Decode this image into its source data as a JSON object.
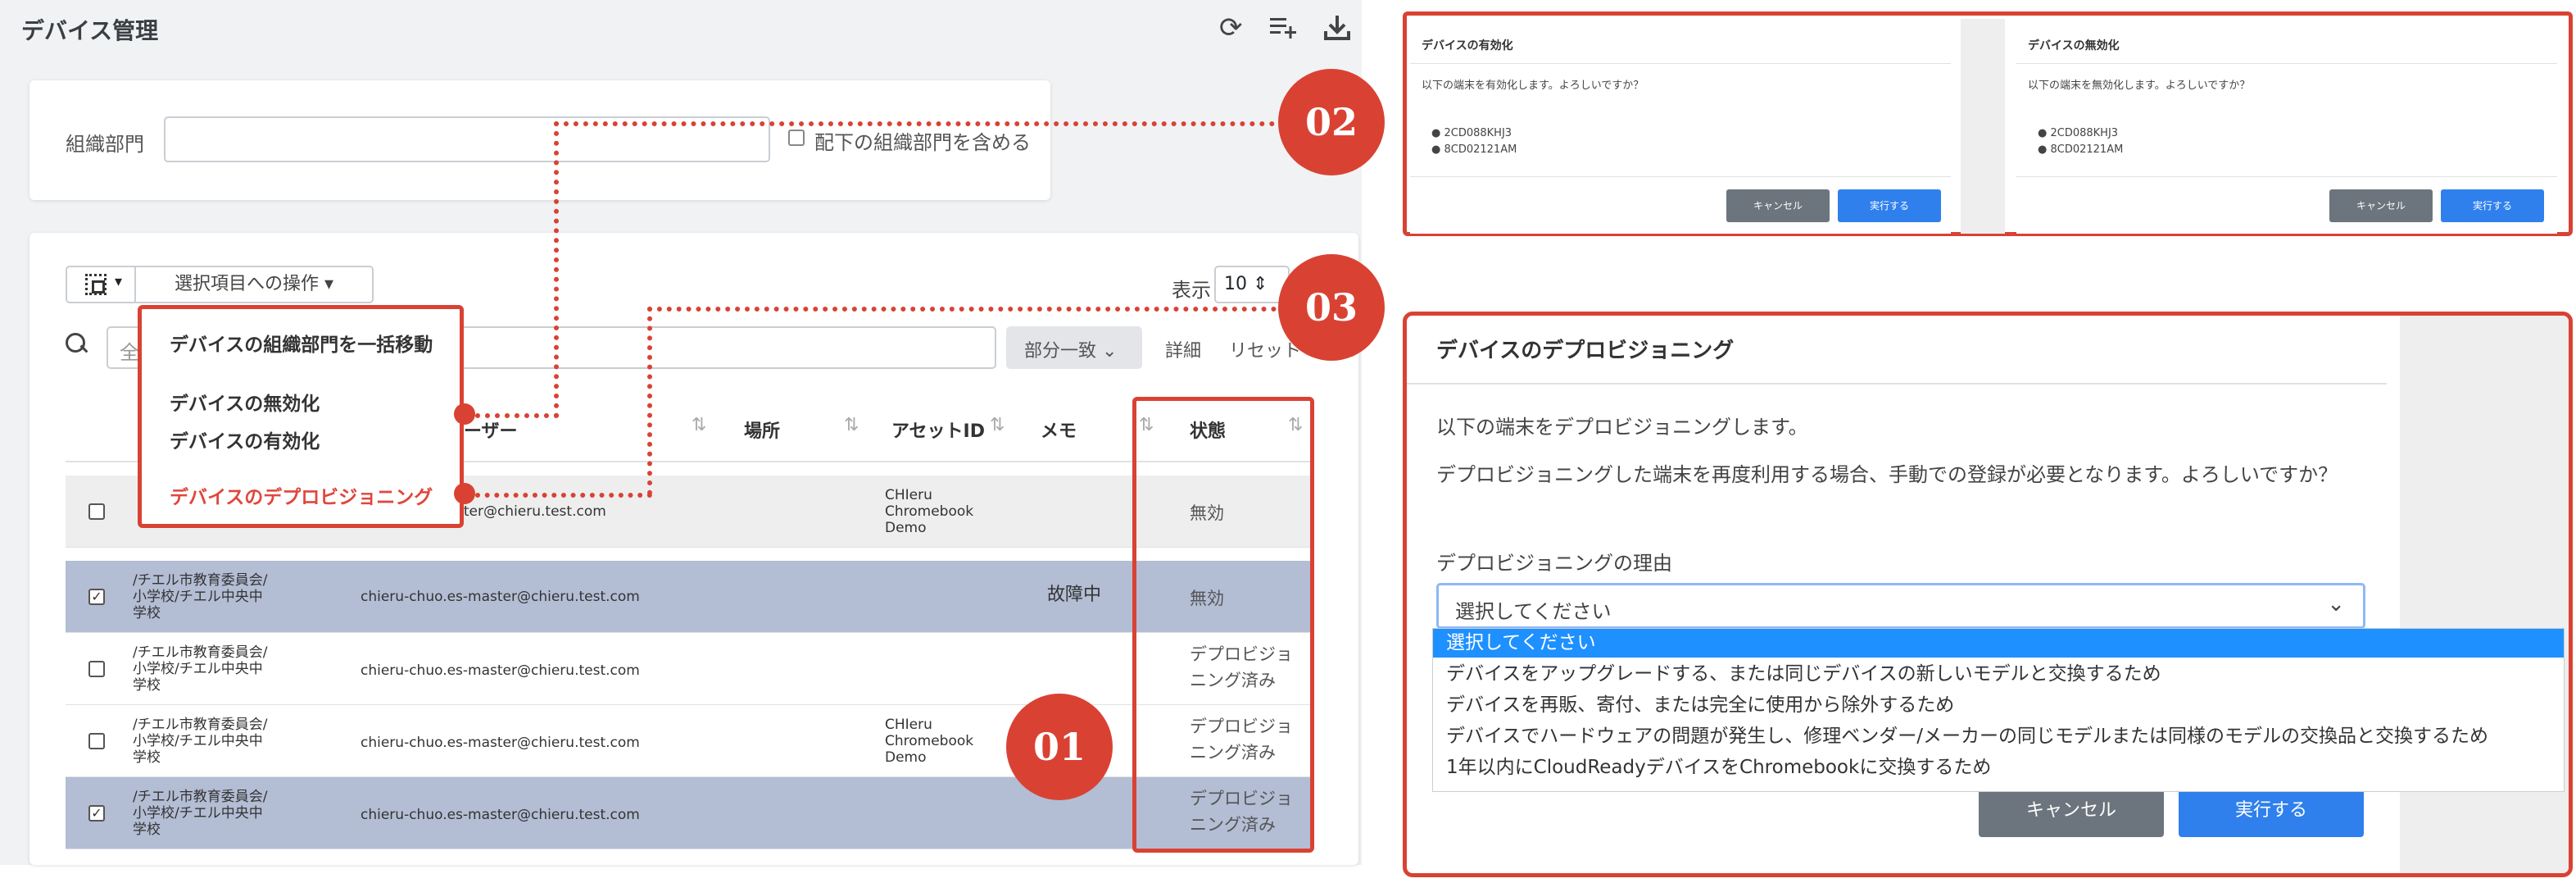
{
  "header": {
    "title": "デバイス管理",
    "refresh_icon": "refresh-icon",
    "add_list_icon": "playlist-add-icon",
    "download_icon": "download-icon"
  },
  "org_filter": {
    "label": "組織部門",
    "input_value": "",
    "include_sub_label": "配下の組織部門を含める"
  },
  "toolbar": {
    "bulk_ops_label": "選択項目への操作",
    "show_label": "表示",
    "page_size": "10"
  },
  "search": {
    "placeholder": "全",
    "match_mode": "部分一致",
    "detail_label": "詳細",
    "reset_label": "リセット"
  },
  "table": {
    "columns": [
      "ーザー",
      "場所",
      "アセットID",
      "メモ",
      "状態"
    ],
    "rows": [
      {
        "checked": false,
        "org": "",
        "user": "master@chieru.test.com",
        "asset": "CHIeru\nChromebook\nDemo",
        "memo": "",
        "status": "無効"
      },
      {
        "checked": true,
        "org": "/チエル市教育委員会/\n小学校/チエル中央中\n学校",
        "user": "chieru-chuo.es-master@chieru.test.com",
        "asset": "",
        "memo": "故障中",
        "status": "無効"
      },
      {
        "checked": false,
        "org": "/チエル市教育委員会/\n小学校/チエル中央中\n学校",
        "user": "chieru-chuo.es-master@chieru.test.com",
        "asset": "",
        "memo": "",
        "status": "デプロビジョ\nニング済み"
      },
      {
        "checked": false,
        "org": "/チエル市教育委員会/\n小学校/チエル中央中\n学校",
        "user": "chieru-chuo.es-master@chieru.test.com",
        "asset": "CHIeru\nChromebook\nDemo",
        "memo": "",
        "status": "デプロビジョ\nニング済み"
      },
      {
        "checked": true,
        "org": "/チエル市教育委員会/\n小学校/チエル中央中\n学校",
        "user": "chieru-chuo.es-master@chieru.test.com",
        "asset": "",
        "memo": "",
        "status": "デプロビジョ\nニング済み"
      }
    ]
  },
  "dropdown_menu": {
    "items": [
      "デバイスの組織部門を一括移動",
      "デバイスの無効化",
      "デバイスの有効化",
      "デバイスのデプロビジョニング"
    ]
  },
  "badges": [
    "01",
    "02",
    "03"
  ],
  "dialog_enable": {
    "title": "デバイスの有効化",
    "message": "以下の端末を有効化します。よろしいですか？",
    "devices": [
      "2CD088KHJ3",
      "8CD02121AM"
    ],
    "cancel": "キャンセル",
    "run": "実行する"
  },
  "dialog_disable": {
    "title": "デバイスの無効化",
    "message": "以下の端末を無効化します。よろしいですか？",
    "devices": [
      "2CD088KHJ3",
      "8CD02121AM"
    ],
    "cancel": "キャンセル",
    "run": "実行する"
  },
  "dialog_deprovision": {
    "title": "デバイスのデプロビジョニング",
    "message1": "以下の端末をデプロビジョニングします。",
    "message2": "デプロビジョニングした端末を再度利用する場合、手動での登録が必要となります。よろしいですか？",
    "reason_label": "デプロビジョニングの理由",
    "selected": "選択してください",
    "options": [
      "選択してください",
      "デバイスをアップグレードする、または同じデバイスの新しいモデルと交換するため",
      "デバイスを再販、寄付、または完全に使用から除外するため",
      "デバイスでハードウェアの問題が発生し、修理ベンダー/メーカーの同じモデルまたは同様のモデルの交換品と交換するため",
      "1年以内にCloudReadyデバイスをChromebookに交換するため"
    ],
    "cancel": "キャンセル",
    "run": "実行する"
  },
  "colors": {
    "annotation_red": "#d94233",
    "selected_row": "#b3bdd4",
    "primary_button": "#2f80ed",
    "secondary_button": "#6c757d",
    "option_highlight": "#1e90ff"
  }
}
